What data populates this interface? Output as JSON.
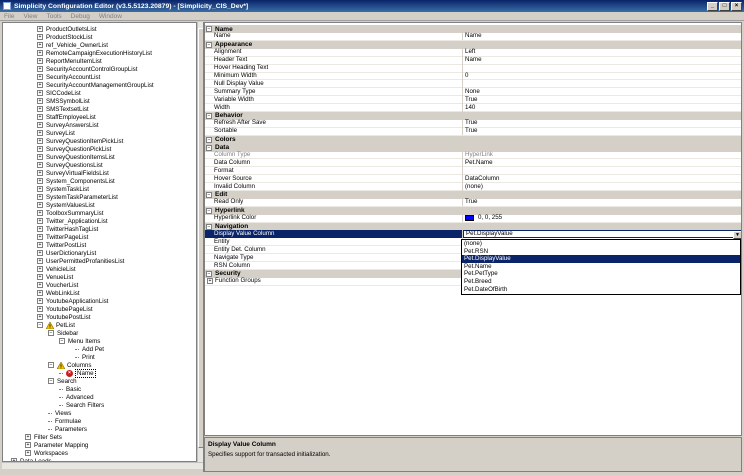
{
  "window": {
    "title": "Simplicity Configuration Editor (v3.5.5123.20879) - [Simplicity_CIS_Dev*]"
  },
  "menu": [
    "File",
    "View",
    "Tools",
    "Debug",
    "Window"
  ],
  "tree": [
    {
      "label": "ProductOutletsList",
      "level": 1,
      "icon": "plus"
    },
    {
      "label": "ProductStockList",
      "level": 1,
      "icon": "plus"
    },
    {
      "label": "ref_Vehicle_OwnerList",
      "level": 1,
      "icon": "plus"
    },
    {
      "label": "RemoteCampaignExecutionHistoryList",
      "level": 1,
      "icon": "plus"
    },
    {
      "label": "ReportMenuItemList",
      "level": 1,
      "icon": "plus"
    },
    {
      "label": "SecurityAccountControlGroupList",
      "level": 1,
      "icon": "plus"
    },
    {
      "label": "SecurityAccountList",
      "level": 1,
      "icon": "plus"
    },
    {
      "label": "SecurityAccountManagementGroupList",
      "level": 1,
      "icon": "plus"
    },
    {
      "label": "SICCodeList",
      "level": 1,
      "icon": "plus"
    },
    {
      "label": "SMSSymbolList",
      "level": 1,
      "icon": "plus"
    },
    {
      "label": "SMSTextsetList",
      "level": 1,
      "icon": "plus"
    },
    {
      "label": "StaffEmployeeList",
      "level": 1,
      "icon": "plus"
    },
    {
      "label": "SurveyAnswersList",
      "level": 1,
      "icon": "plus"
    },
    {
      "label": "SurveyList",
      "level": 1,
      "icon": "plus"
    },
    {
      "label": "SurveyQuestionItemPickList",
      "level": 1,
      "icon": "plus"
    },
    {
      "label": "SurveyQuestionPickList",
      "level": 1,
      "icon": "plus"
    },
    {
      "label": "SurveyQuestionItemsList",
      "level": 1,
      "icon": "plus"
    },
    {
      "label": "SurveyQuestionsList",
      "level": 1,
      "icon": "plus"
    },
    {
      "label": "SurveyVirtualFieldsList",
      "level": 1,
      "icon": "plus"
    },
    {
      "label": "System_ComponentsList",
      "level": 1,
      "icon": "plus"
    },
    {
      "label": "SystemTaskList",
      "level": 1,
      "icon": "plus"
    },
    {
      "label": "SystemTaskParameterList",
      "level": 1,
      "icon": "plus"
    },
    {
      "label": "SystemValuesList",
      "level": 1,
      "icon": "plus"
    },
    {
      "label": "ToolboxSummaryList",
      "level": 1,
      "icon": "plus"
    },
    {
      "label": "Twitter_ApplicationList",
      "level": 1,
      "icon": "plus"
    },
    {
      "label": "TwitterHashTagList",
      "level": 1,
      "icon": "plus"
    },
    {
      "label": "TwitterPageList",
      "level": 1,
      "icon": "plus"
    },
    {
      "label": "TwitterPostList",
      "level": 1,
      "icon": "plus"
    },
    {
      "label": "UserDictionaryList",
      "level": 1,
      "icon": "plus"
    },
    {
      "label": "UserPermittedProfanitiesList",
      "level": 1,
      "icon": "plus"
    },
    {
      "label": "VehicleList",
      "level": 1,
      "icon": "plus"
    },
    {
      "label": "VenueList",
      "level": 1,
      "icon": "plus"
    },
    {
      "label": "VoucherList",
      "level": 1,
      "icon": "plus"
    },
    {
      "label": "WebLinkList",
      "level": 1,
      "icon": "plus"
    },
    {
      "label": "YoutubeApplicationList",
      "level": 1,
      "icon": "plus"
    },
    {
      "label": "YoutubePageList",
      "level": 1,
      "icon": "plus"
    },
    {
      "label": "YoutubePostList",
      "level": 1,
      "icon": "plus"
    },
    {
      "label": "PetList",
      "level": 1,
      "icon": "minus-warn"
    },
    {
      "label": "Sidebar",
      "level": 2,
      "icon": "minus"
    },
    {
      "label": "Menu Items",
      "level": 3,
      "icon": "minus"
    },
    {
      "label": "Add Pet",
      "level": 4,
      "icon": "dash"
    },
    {
      "label": "Print",
      "level": 4,
      "icon": "dash"
    },
    {
      "label": "Columns",
      "level": 2,
      "icon": "minus-warn"
    },
    {
      "label": "Name",
      "level": 3,
      "icon": "error",
      "selected": true
    },
    {
      "label": "Search",
      "level": 2,
      "icon": "minus"
    },
    {
      "label": "Basic",
      "level": 3,
      "icon": "dash"
    },
    {
      "label": "Advanced",
      "level": 3,
      "icon": "dash"
    },
    {
      "label": "Search Filters",
      "level": 3,
      "icon": "dash"
    },
    {
      "label": "Views",
      "level": 2,
      "icon": "dash"
    },
    {
      "label": "Formulae",
      "level": 2,
      "icon": "dash"
    },
    {
      "label": "Parameters",
      "level": 2,
      "icon": "dash"
    },
    {
      "label": "Filter Sets",
      "level": 0,
      "icon": "plus"
    },
    {
      "label": "Parameter Mapping",
      "level": 0,
      "icon": "plus"
    },
    {
      "label": "Workspaces",
      "level": 0,
      "icon": "plus"
    },
    {
      "label": "Data Loads",
      "level": -1,
      "icon": "plus"
    }
  ],
  "properties": [
    {
      "kind": "cat",
      "label": "Name"
    },
    {
      "name": "Name",
      "value": "Name"
    },
    {
      "kind": "cat",
      "label": "Appearance"
    },
    {
      "name": "Alignment",
      "value": "Left"
    },
    {
      "name": "Header Text",
      "value": "Name"
    },
    {
      "name": "Hover Heading Text",
      "value": ""
    },
    {
      "name": "Minimum Width",
      "value": "0"
    },
    {
      "name": "Null Display Value",
      "value": ""
    },
    {
      "name": "Summary Type",
      "value": "None"
    },
    {
      "name": "Variable Width",
      "value": "True"
    },
    {
      "name": "Width",
      "value": "140"
    },
    {
      "kind": "cat",
      "label": "Behavior"
    },
    {
      "name": "Refresh After Save",
      "value": "True"
    },
    {
      "name": "Sortable",
      "value": "True"
    },
    {
      "kind": "cat",
      "label": "Colors"
    },
    {
      "kind": "cat",
      "label": "Data"
    },
    {
      "name": "Column Type",
      "value": "HyperLink",
      "gray": true
    },
    {
      "name": "Data Column",
      "value": "Pet.Name"
    },
    {
      "name": "Format",
      "value": ""
    },
    {
      "name": "Hover Source",
      "value": "DataColumn"
    },
    {
      "name": "Invalid Column",
      "value": "(none)"
    },
    {
      "kind": "cat",
      "label": "Edit"
    },
    {
      "name": "Read Only",
      "value": "True"
    },
    {
      "kind": "cat",
      "label": "Hyperlink"
    },
    {
      "name": "Hyperlink Color",
      "value": "0, 0, 255",
      "swatch": true
    },
    {
      "kind": "cat",
      "label": "Navigation"
    },
    {
      "name": "Display Value Column",
      "value": "Pet.DisplayValue",
      "selected": true
    },
    {
      "name": "Entity",
      "value": ""
    },
    {
      "name": "Entity Det. Column",
      "value": ""
    },
    {
      "name": "Navigate Type",
      "value": ""
    },
    {
      "name": "RSN Column",
      "value": ""
    },
    {
      "kind": "cat",
      "label": "Security"
    },
    {
      "name": "Function Groups",
      "value": "",
      "expander": true
    }
  ],
  "dropdown": {
    "options": [
      "(none)",
      "Pet.RSN",
      "Pet.DisplayValue",
      "Pet.Name",
      "Pet.PetType",
      "Pet.Breed",
      "Pet.DateOfBirth"
    ],
    "selected_index": 2
  },
  "description": {
    "title": "Display Value Column",
    "text": "Specifies support for transacted initialization."
  },
  "colors": {
    "titlebar": "#0a246a",
    "selection": "#0a246a",
    "hyperlink": "#0000ff",
    "error": "#c81e1e"
  }
}
